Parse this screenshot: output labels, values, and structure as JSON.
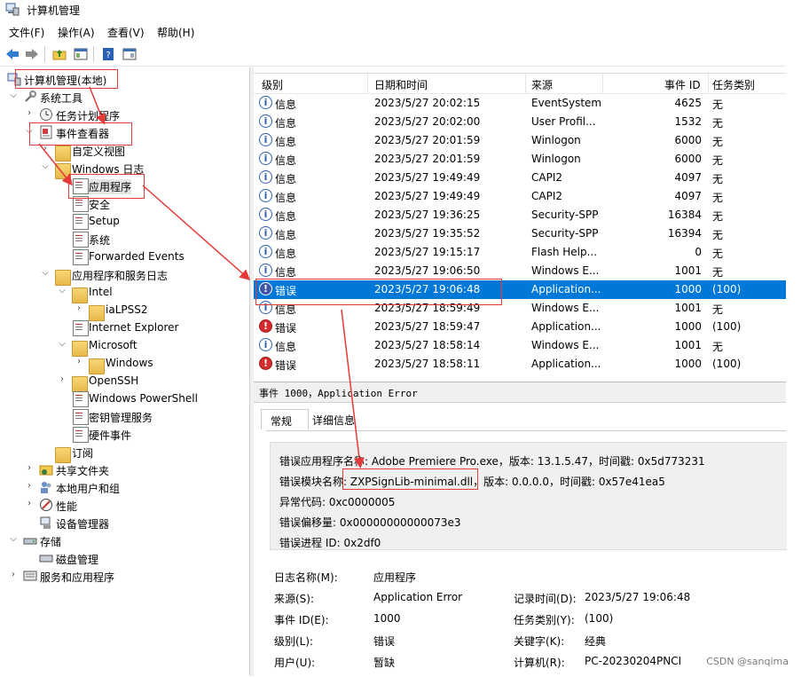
{
  "window": {
    "title": "计算机管理"
  },
  "menu": [
    "文件(F)",
    "操作(A)",
    "查看(V)",
    "帮助(H)"
  ],
  "tree": {
    "root": "计算机管理(本地)",
    "system_tools": "系统工具",
    "task_scheduler": "任务计划程序",
    "event_viewer": "事件查看器",
    "custom_views": "自定义视图",
    "windows_logs": "Windows 日志",
    "application": "应用程序",
    "security": "安全",
    "setup": "Setup",
    "system": "系统",
    "forwarded_events": "Forwarded Events",
    "app_service_logs": "应用程序和服务日志",
    "intel": "Intel",
    "ialpss2": "iaLPSS2",
    "internet_explorer": "Internet Explorer",
    "microsoft": "Microsoft",
    "windows": "Windows",
    "openssh": "OpenSSH",
    "powershell": "Windows PowerShell",
    "key_mgmt": "密钥管理服务",
    "hardware_events": "硬件事件",
    "subscriptions": "订阅",
    "shared_folders": "共享文件夹",
    "local_users": "本地用户和组",
    "performance": "性能",
    "device_manager": "设备管理器",
    "storage": "存储",
    "disk_mgmt": "磁盘管理",
    "services_apps": "服务和应用程序"
  },
  "list": {
    "headers": {
      "level": "级别",
      "datetime": "日期和时间",
      "source": "来源",
      "event_id": "事件 ID",
      "task": "任务类别"
    },
    "rows": [
      {
        "level": "信息",
        "datetime": "2023/5/27 20:02:15",
        "source": "EventSystem",
        "id": "4625",
        "task": "无"
      },
      {
        "level": "信息",
        "datetime": "2023/5/27 20:02:00",
        "source": "User Profil...",
        "id": "1532",
        "task": "无"
      },
      {
        "level": "信息",
        "datetime": "2023/5/27 20:01:59",
        "source": "Winlogon",
        "id": "6000",
        "task": "无"
      },
      {
        "level": "信息",
        "datetime": "2023/5/27 20:01:59",
        "source": "Winlogon",
        "id": "6000",
        "task": "无"
      },
      {
        "level": "信息",
        "datetime": "2023/5/27 19:49:49",
        "source": "CAPI2",
        "id": "4097",
        "task": "无"
      },
      {
        "level": "信息",
        "datetime": "2023/5/27 19:49:49",
        "source": "CAPI2",
        "id": "4097",
        "task": "无"
      },
      {
        "level": "信息",
        "datetime": "2023/5/27 19:36:25",
        "source": "Security-SPP",
        "id": "16384",
        "task": "无"
      },
      {
        "level": "信息",
        "datetime": "2023/5/27 19:35:52",
        "source": "Security-SPP",
        "id": "16394",
        "task": "无"
      },
      {
        "level": "信息",
        "datetime": "2023/5/27 19:15:17",
        "source": "Flash Help...",
        "id": "0",
        "task": "无"
      },
      {
        "level": "信息",
        "datetime": "2023/5/27 19:06:50",
        "source": "Windows E...",
        "id": "1001",
        "task": "无"
      },
      {
        "level": "错误",
        "datetime": "2023/5/27 19:06:48",
        "source": "Application...",
        "id": "1000",
        "task": "(100)"
      },
      {
        "level": "信息",
        "datetime": "2023/5/27 18:59:49",
        "source": "Windows E...",
        "id": "1001",
        "task": "无"
      },
      {
        "level": "错误",
        "datetime": "2023/5/27 18:59:47",
        "source": "Application...",
        "id": "1000",
        "task": "(100)"
      },
      {
        "level": "信息",
        "datetime": "2023/5/27 18:58:14",
        "source": "Windows E...",
        "id": "1001",
        "task": "无"
      },
      {
        "level": "错误",
        "datetime": "2023/5/27 18:58:11",
        "source": "Application...",
        "id": "1000",
        "task": "(100)"
      }
    ]
  },
  "detail": {
    "title": "事件 1000，Application Error",
    "tab_general": "常规",
    "tab_details": "详细信息",
    "msg1": "错误应用程序名称: Adobe Premiere Pro.exe，版本: 13.1.5.47，时间戳: 0x5d773231",
    "msg2_prefix": "错误模块名称: ",
    "msg2_module": "ZXPSignLib-minimal.dll，",
    "msg2_suffix": "版本: 0.0.0.0，时间戳: 0x57e41ea5",
    "msg3": "异常代码: 0xc0000005",
    "msg4": "错误偏移量: 0x00000000000073e3",
    "msg5": "错误进程 ID: 0x2df0",
    "log_name_label": "日志名称(M):",
    "log_name": "应用程序",
    "source_label": "来源(S):",
    "source": "Application Error",
    "logged_label": "记录时间(D):",
    "logged": "2023/5/27 19:06:48",
    "event_id_label": "事件 ID(E):",
    "event_id": "1000",
    "task_label": "任务类别(Y):",
    "task": "(100)",
    "level_label": "级别(L):",
    "level": "错误",
    "keywords_label": "关键字(K):",
    "keywords": "经典",
    "user_label": "用户(U):",
    "user": "暂缺",
    "computer_label": "计算机(R):",
    "computer": "PC-20230204PNCI"
  },
  "watermark": "CSDN @sanqima"
}
